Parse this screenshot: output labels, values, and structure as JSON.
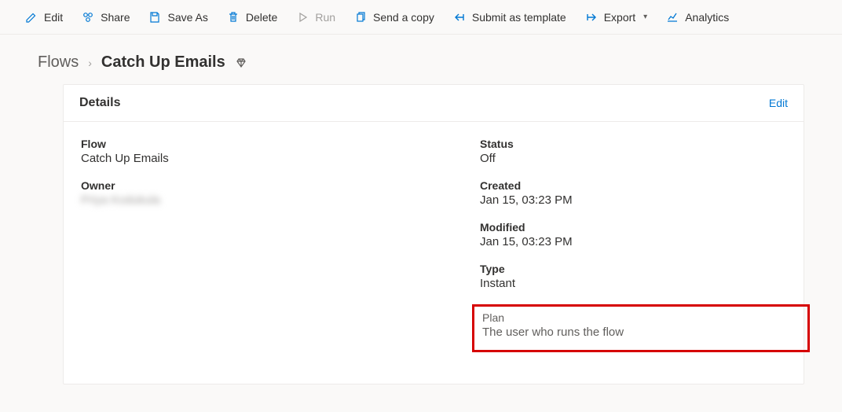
{
  "toolbar": {
    "edit": "Edit",
    "share": "Share",
    "save_as": "Save As",
    "delete": "Delete",
    "run": "Run",
    "send_copy": "Send a copy",
    "submit_template": "Submit as template",
    "export": "Export",
    "analytics": "Analytics"
  },
  "breadcrumb": {
    "root": "Flows",
    "current": "Catch Up Emails"
  },
  "card": {
    "title": "Details",
    "edit_link": "Edit"
  },
  "left": {
    "flow_label": "Flow",
    "flow_value": "Catch Up Emails",
    "owner_label": "Owner",
    "owner_value": "Priya Kodukula"
  },
  "right": {
    "status_label": "Status",
    "status_value": "Off",
    "created_label": "Created",
    "created_value": "Jan 15, 03:23 PM",
    "modified_label": "Modified",
    "modified_value": "Jan 15, 03:23 PM",
    "type_label": "Type",
    "type_value": "Instant",
    "plan_label": "Plan",
    "plan_value": "The user who runs the flow"
  }
}
